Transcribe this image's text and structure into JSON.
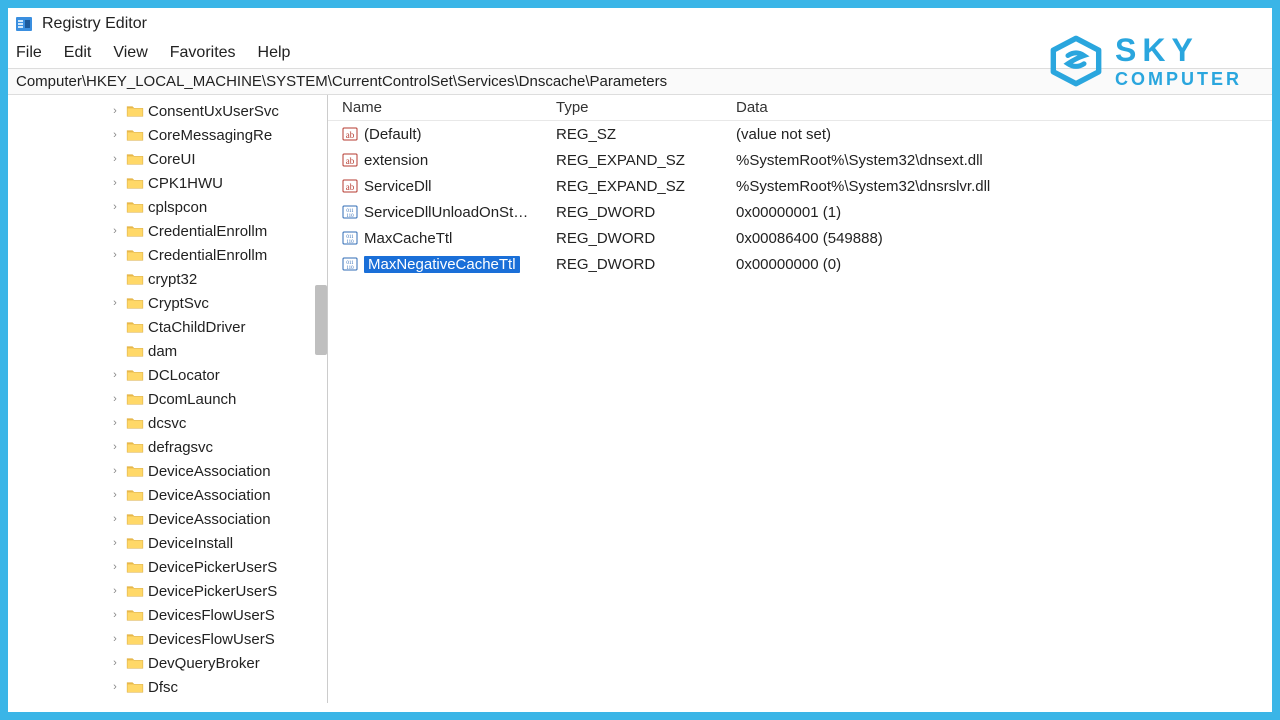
{
  "titlebar": {
    "title": "Registry Editor"
  },
  "menubar": [
    "File",
    "Edit",
    "View",
    "Favorites",
    "Help"
  ],
  "address": "Computer\\HKEY_LOCAL_MACHINE\\SYSTEM\\CurrentControlSet\\Services\\Dnscache\\Parameters",
  "tree": [
    {
      "label": "ConsentUxUserSvc",
      "expandable": true
    },
    {
      "label": "CoreMessagingRe",
      "expandable": true
    },
    {
      "label": "CoreUI",
      "expandable": true
    },
    {
      "label": "CPK1HWU",
      "expandable": true
    },
    {
      "label": "cplspcon",
      "expandable": true
    },
    {
      "label": "CredentialEnrollm",
      "expandable": true
    },
    {
      "label": "CredentialEnrollm",
      "expandable": true
    },
    {
      "label": "crypt32",
      "expandable": false
    },
    {
      "label": "CryptSvc",
      "expandable": true
    },
    {
      "label": "CtaChildDriver",
      "expandable": false
    },
    {
      "label": "dam",
      "expandable": false
    },
    {
      "label": "DCLocator",
      "expandable": true
    },
    {
      "label": "DcomLaunch",
      "expandable": true
    },
    {
      "label": "dcsvc",
      "expandable": true
    },
    {
      "label": "defragsvc",
      "expandable": true
    },
    {
      "label": "DeviceAssociation",
      "expandable": true
    },
    {
      "label": "DeviceAssociation",
      "expandable": true
    },
    {
      "label": "DeviceAssociation",
      "expandable": true
    },
    {
      "label": "DeviceInstall",
      "expandable": true
    },
    {
      "label": "DevicePickerUserS",
      "expandable": true
    },
    {
      "label": "DevicePickerUserS",
      "expandable": true
    },
    {
      "label": "DevicesFlowUserS",
      "expandable": true
    },
    {
      "label": "DevicesFlowUserS",
      "expandable": true
    },
    {
      "label": "DevQueryBroker",
      "expandable": true
    },
    {
      "label": "Dfsc",
      "expandable": true
    }
  ],
  "columns": {
    "name": "Name",
    "type": "Type",
    "data": "Data"
  },
  "values": [
    {
      "name": "(Default)",
      "type": "REG_SZ",
      "data": "(value not set)",
      "kind": "string",
      "selected": false
    },
    {
      "name": "extension",
      "type": "REG_EXPAND_SZ",
      "data": "%SystemRoot%\\System32\\dnsext.dll",
      "kind": "string",
      "selected": false
    },
    {
      "name": "ServiceDll",
      "type": "REG_EXPAND_SZ",
      "data": "%SystemRoot%\\System32\\dnsrslvr.dll",
      "kind": "string",
      "selected": false
    },
    {
      "name": "ServiceDllUnloadOnSt…",
      "type": "REG_DWORD",
      "data": "0x00000001 (1)",
      "kind": "binary",
      "selected": false
    },
    {
      "name": "MaxCacheTtl",
      "type": "REG_DWORD",
      "data": "0x00086400 (549888)",
      "kind": "binary",
      "selected": false
    },
    {
      "name": "MaxNegativeCacheTtl",
      "type": "REG_DWORD",
      "data": "0x00000000 (0)",
      "kind": "binary",
      "selected": true
    }
  ],
  "logo": {
    "top": "SKY",
    "bottom": "COMPUTER"
  }
}
